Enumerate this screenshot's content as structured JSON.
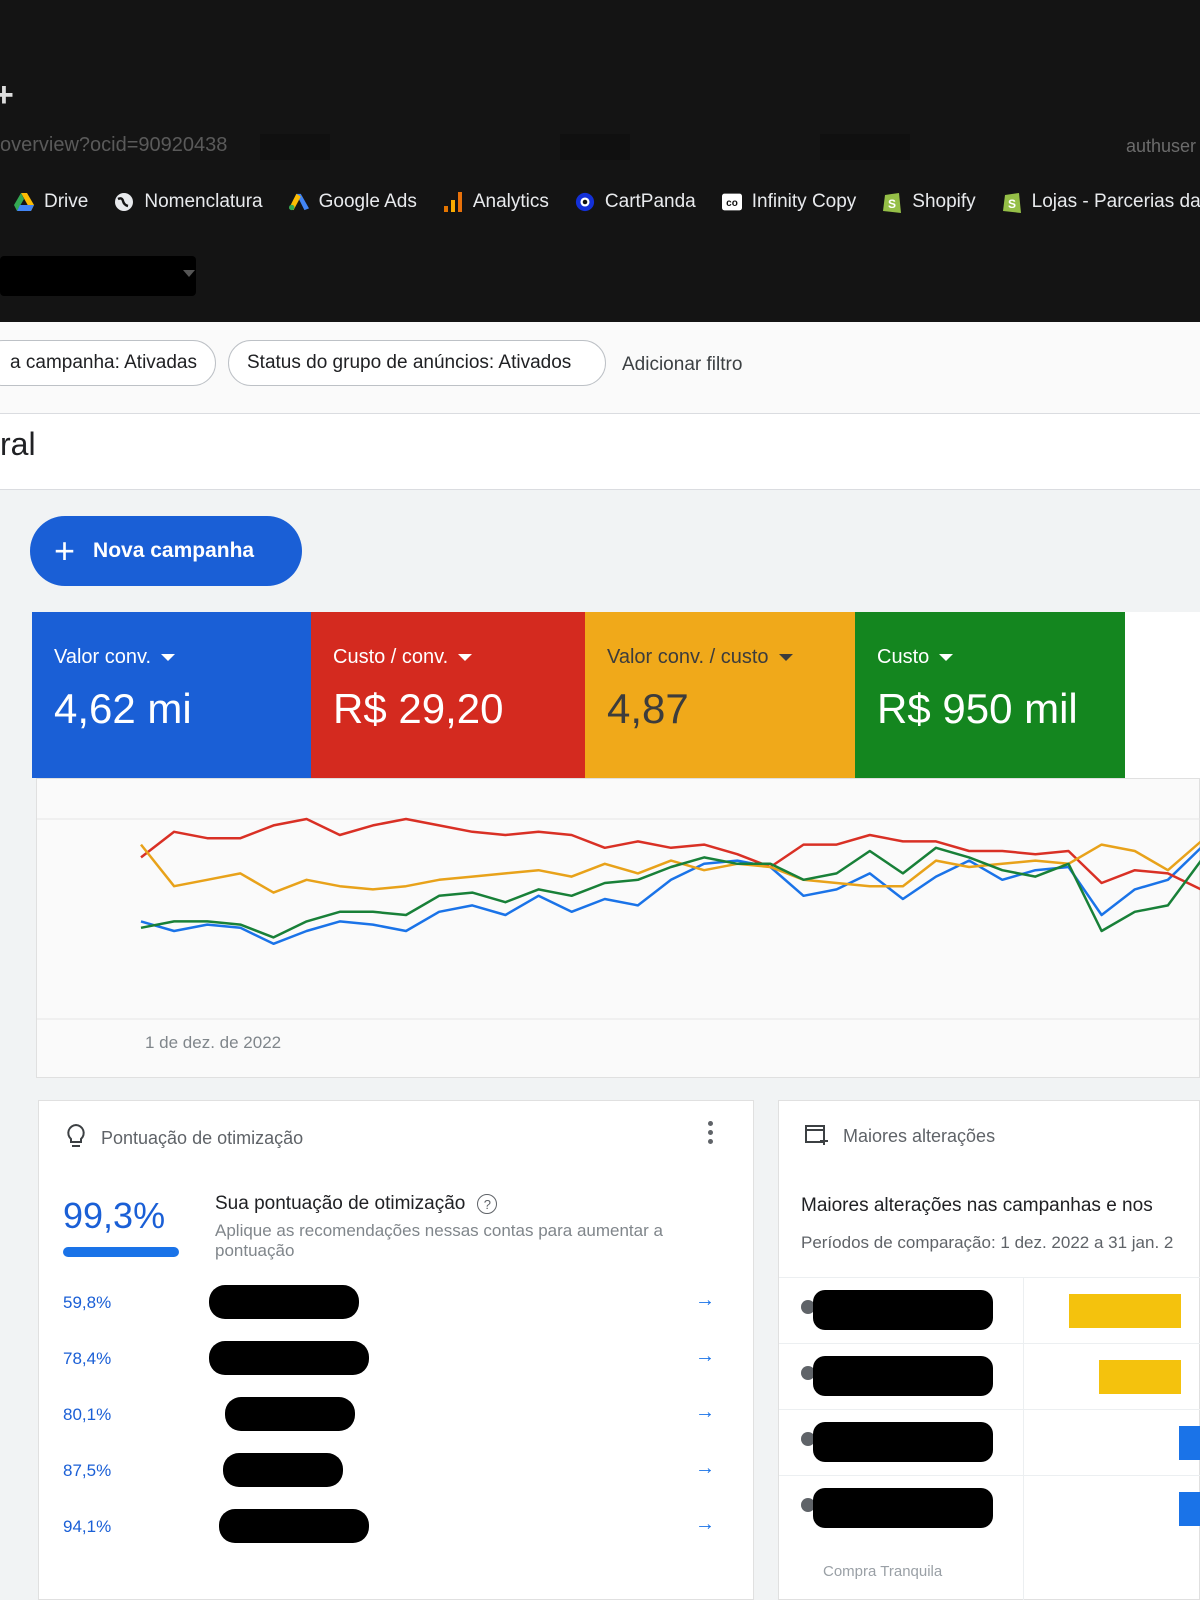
{
  "browser": {
    "url": "overview?ocid=90920438",
    "url_tail": "authuser",
    "bookmarks": [
      {
        "label": "Drive",
        "icon": "drive-icon"
      },
      {
        "label": "Nomenclatura",
        "icon": "globe-icon"
      },
      {
        "label": "Google Ads",
        "icon": "google-ads-icon"
      },
      {
        "label": "Analytics",
        "icon": "analytics-icon"
      },
      {
        "label": "CartPanda",
        "icon": "cartpanda-icon"
      },
      {
        "label": "Infinity Copy",
        "icon": "infinity-copy-icon"
      },
      {
        "label": "Shopify",
        "icon": "shopify-icon"
      },
      {
        "label": "Lojas - Parcerias da...",
        "icon": "shopify-icon"
      }
    ]
  },
  "filters": {
    "chip_1": "a campanha: Ativadas",
    "chip_2": "Status do grupo de anúncios: Ativados",
    "add": "Adicionar filtro"
  },
  "page": {
    "title": "ral"
  },
  "new_campaign": {
    "label": "Nova campanha"
  },
  "metrics": [
    {
      "label": "Valor conv.",
      "value": "4,62 mi",
      "color": "#1a5fd6"
    },
    {
      "label": "Custo / conv.",
      "value": "R$ 29,20",
      "color": "#d42a1f"
    },
    {
      "label": "Valor conv. / custo",
      "value": "4,87",
      "color": "#f0a91a"
    },
    {
      "label": "Custo",
      "value": "R$ 950 mil",
      "color": "#14861f"
    }
  ],
  "chart_data": {
    "type": "line",
    "x_start_label": "1 de dez. de 2022",
    "series": [
      {
        "name": "Valor conv.",
        "color": "#1a73e8",
        "values": [
          0.36,
          0.3,
          0.34,
          0.32,
          0.22,
          0.3,
          0.36,
          0.34,
          0.3,
          0.42,
          0.46,
          0.4,
          0.52,
          0.42,
          0.5,
          0.46,
          0.62,
          0.72,
          0.74,
          0.7,
          0.52,
          0.56,
          0.66,
          0.5,
          0.64,
          0.74,
          0.62,
          0.68,
          0.7,
          0.4,
          0.56,
          0.62,
          0.82
        ]
      },
      {
        "name": "Custo / conv.",
        "color": "#d93025",
        "values": [
          0.76,
          0.92,
          0.88,
          0.88,
          0.96,
          1.0,
          0.9,
          0.96,
          1.0,
          0.96,
          0.92,
          0.9,
          0.92,
          0.9,
          0.82,
          0.86,
          0.82,
          0.84,
          0.78,
          0.7,
          0.84,
          0.84,
          0.9,
          0.86,
          0.86,
          0.8,
          0.8,
          0.78,
          0.8,
          0.6,
          0.68,
          0.66,
          0.56
        ]
      },
      {
        "name": "Valor conv. / custo",
        "color": "#e8a21a",
        "values": [
          0.84,
          0.58,
          0.62,
          0.66,
          0.54,
          0.62,
          0.58,
          0.56,
          0.58,
          0.62,
          0.64,
          0.66,
          0.68,
          0.64,
          0.72,
          0.66,
          0.74,
          0.68,
          0.72,
          0.7,
          0.62,
          0.6,
          0.58,
          0.58,
          0.74,
          0.7,
          0.72,
          0.74,
          0.72,
          0.84,
          0.8,
          0.68,
          0.86
        ]
      },
      {
        "name": "Custo",
        "color": "#188038",
        "values": [
          0.32,
          0.36,
          0.36,
          0.34,
          0.26,
          0.36,
          0.42,
          0.42,
          0.4,
          0.52,
          0.54,
          0.48,
          0.56,
          0.52,
          0.6,
          0.62,
          0.7,
          0.76,
          0.72,
          0.72,
          0.62,
          0.66,
          0.8,
          0.66,
          0.82,
          0.76,
          0.68,
          0.64,
          0.72,
          0.3,
          0.42,
          0.46,
          0.74
        ]
      }
    ]
  },
  "optimization": {
    "header": "Pontuação de otimização",
    "score": "99,3%",
    "title": "Sua pontuação de otimização",
    "help": "?",
    "description": "Aplique as recomendações nessas contas para aumentar a pontuação",
    "rows": [
      {
        "pct": "59,8%"
      },
      {
        "pct": "78,4%"
      },
      {
        "pct": "80,1%"
      },
      {
        "pct": "87,5%"
      },
      {
        "pct": "94,1%"
      }
    ],
    "arrow": "→"
  },
  "changes": {
    "header": "Maiores alterações",
    "title": "Maiores alterações nas campanhas e nos",
    "period": "Períodos de comparação: 1 dez. 2022 a 31 jan. 2",
    "bar_colors": [
      "#f4c20d",
      "#f4c20d",
      "#1a73e8",
      "#1a73e8"
    ],
    "footer": "Compra Tranquila"
  }
}
